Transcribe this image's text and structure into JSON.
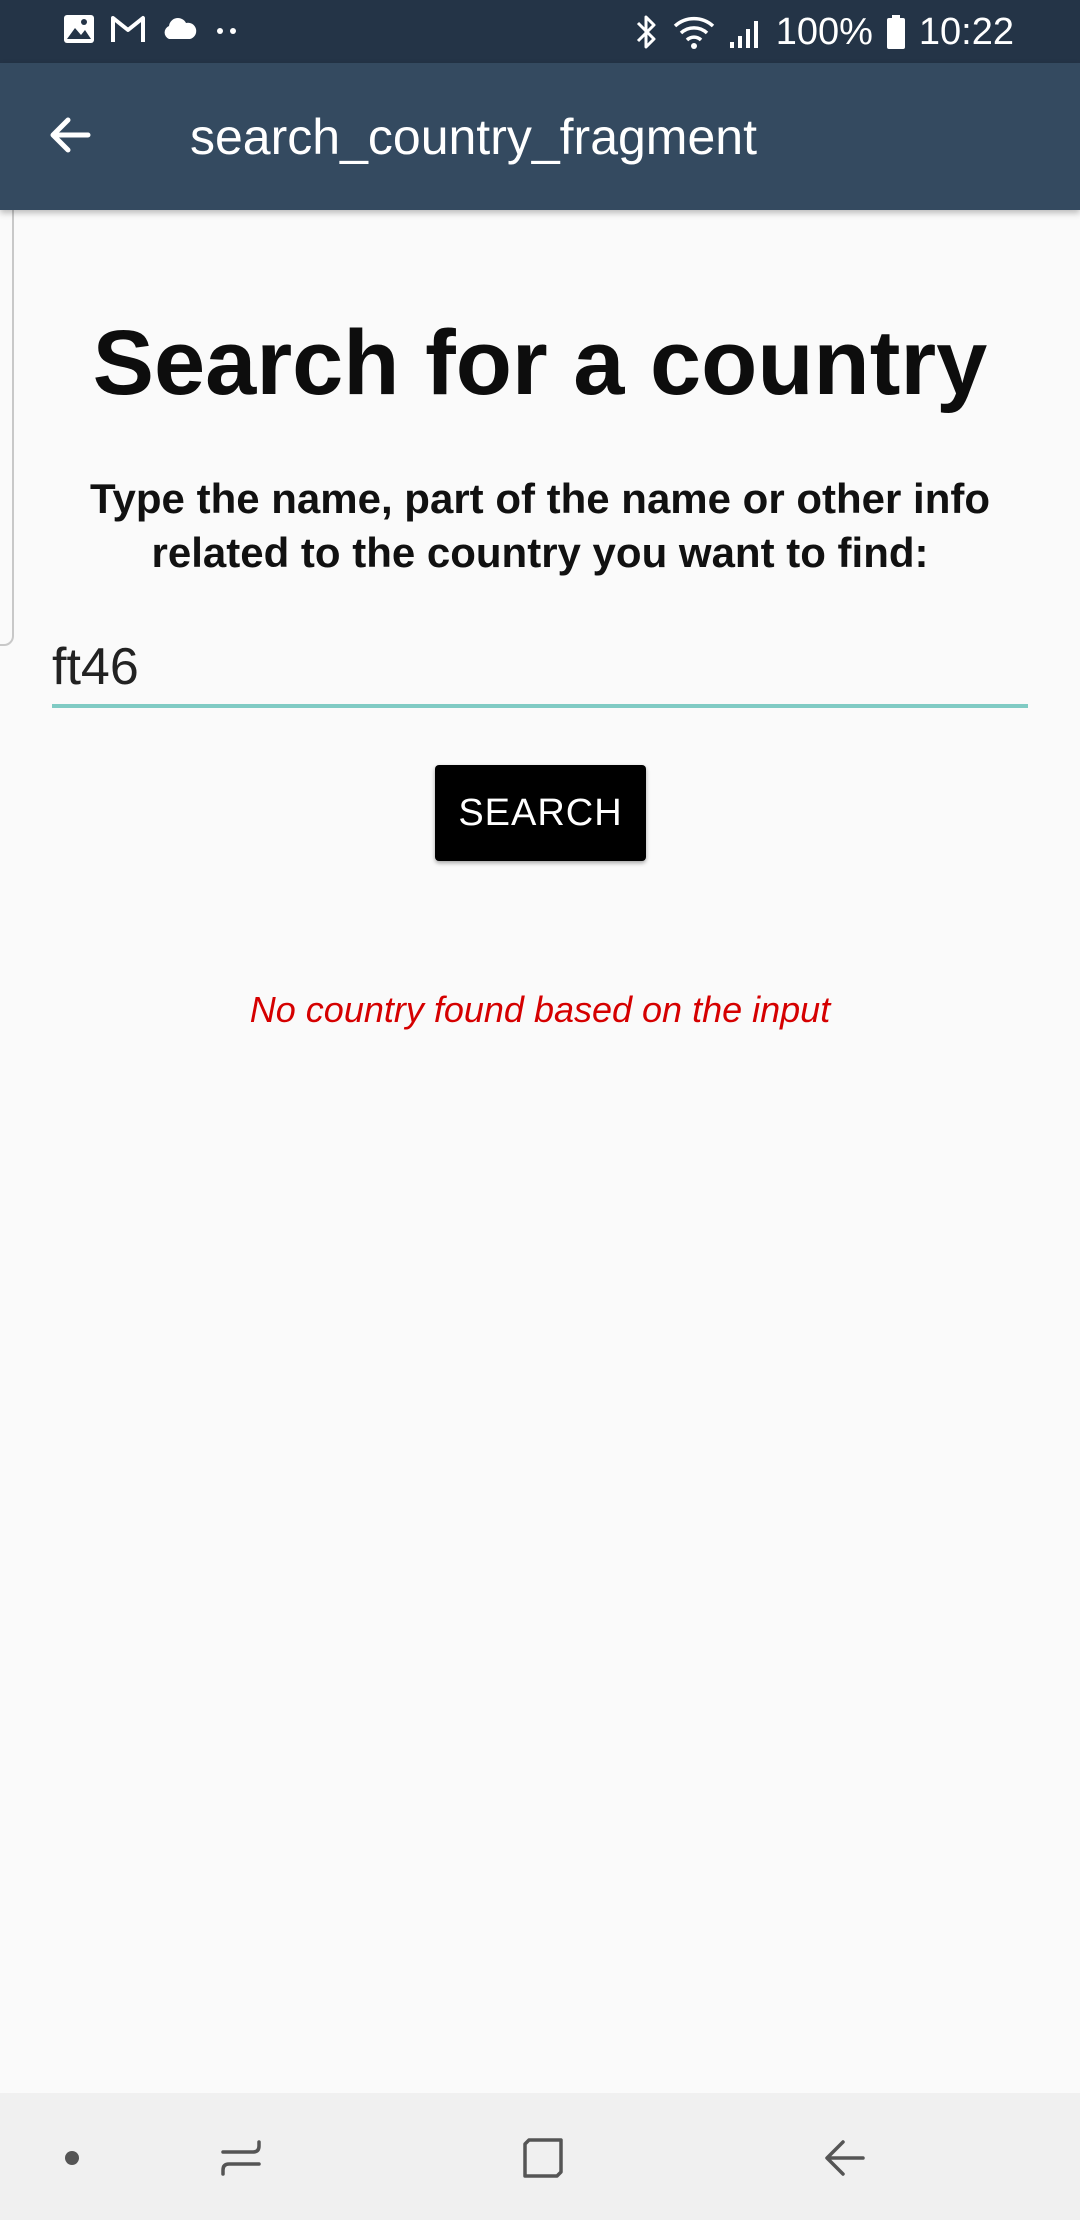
{
  "status_bar": {
    "left_icons": [
      "image-icon",
      "gmail-icon",
      "cloud-icon",
      "more-notifications-icon"
    ],
    "right_icons": [
      "bluetooth-icon",
      "wifi-icon",
      "signal-icon",
      "battery-icon"
    ],
    "battery_text": "100%",
    "time": "10:22"
  },
  "app_bar": {
    "title": "search_country_fragment",
    "back_icon": "arrow-back-icon"
  },
  "main": {
    "heading": "Search for a country",
    "subtitle": "Type the name, part of the name or other info related to the country you want to find:",
    "search_value": "ft46",
    "search_button_label": "SEARCH",
    "message": "No country found based on the input"
  },
  "nav_bar": {
    "items": [
      "dot-icon",
      "recent-apps-icon",
      "home-icon",
      "back-icon"
    ]
  },
  "colors": {
    "status_bar": "#243447",
    "app_bar": "#344a60",
    "background": "#fafafa",
    "input_underline": "#80cbc4",
    "button": "#000000",
    "error_text": "#d50000"
  }
}
